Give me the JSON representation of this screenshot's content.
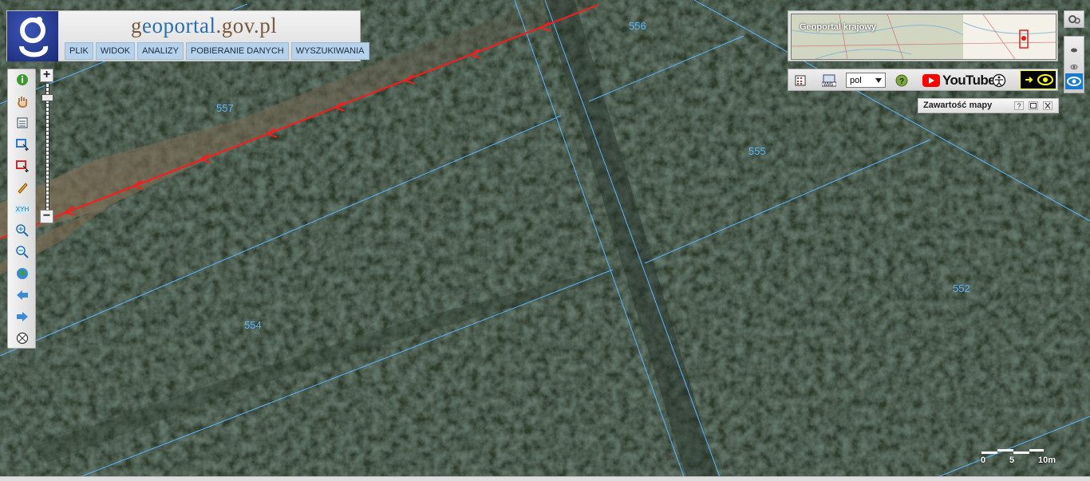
{
  "header": {
    "logo_letter": "g",
    "site_title_part1": "g",
    "site_title_part2": "eoportal",
    "site_title_part3": ".gov.pl",
    "menu": [
      "PLIK",
      "WIDOK",
      "ANALIZY",
      "POBIERANIE DANYCH",
      "WYSZUKIWANIA"
    ]
  },
  "toolbar": {
    "tools": [
      "info-icon",
      "pan-hand-icon",
      "legend-icon",
      "select-box-blue-icon",
      "select-box-red-icon",
      "pencil-icon",
      "xyh-icon",
      "zoom-in-icon",
      "zoom-out-icon",
      "globe-icon",
      "back-arrow-icon",
      "forward-arrow-icon",
      "clear-icon"
    ],
    "xyh_label": "XYH",
    "zoom_plus": "+",
    "zoom_minus": "−"
  },
  "overview": {
    "title": "Geoportal krajowy"
  },
  "top_toolbar": {
    "language": "pol",
    "youtube_label": "YouTube",
    "help": "?"
  },
  "map_content_panel": {
    "title": "Zawartość mapy",
    "help_btn": "?"
  },
  "parcels": [
    "556",
    "557",
    "555",
    "554",
    "552"
  ],
  "scale": {
    "labels": [
      "0",
      "5",
      "10m"
    ]
  },
  "colors": {
    "parcel_line": "#5ab4ff",
    "parcel_label": "#5ab4ff",
    "route_line": "#ff1a1a",
    "menu_bg": "#b6d2ea"
  }
}
